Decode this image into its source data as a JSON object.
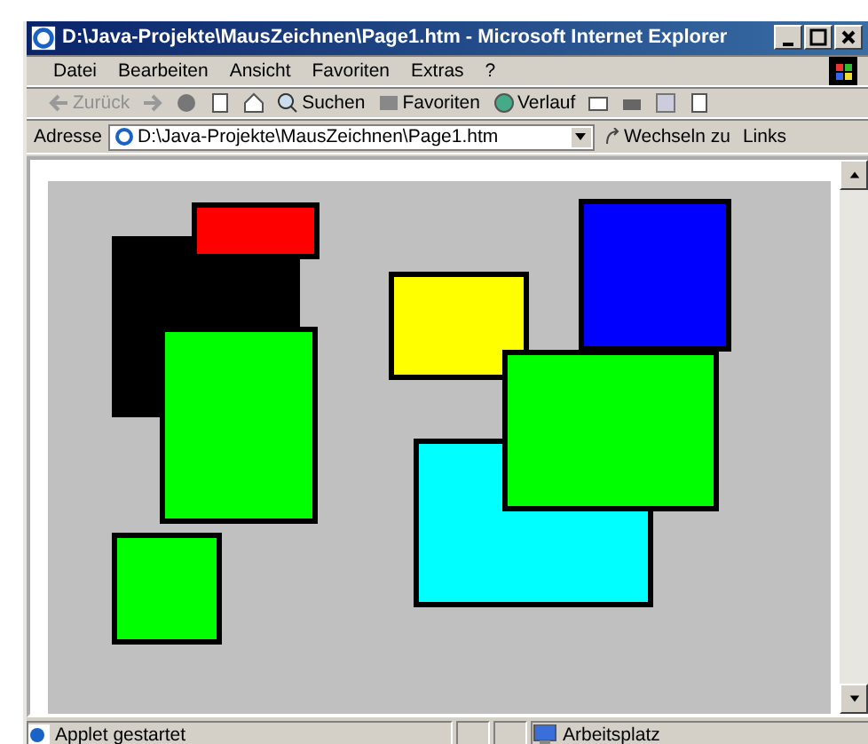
{
  "window": {
    "title": "D:\\Java-Projekte\\MausZeichnen\\Page1.htm - Microsoft Internet Explorer"
  },
  "menu": [
    "Datei",
    "Bearbeiten",
    "Ansicht",
    "Favoriten",
    "Extras",
    "?"
  ],
  "toolbar": [
    {
      "kind": "back",
      "label": "Zurück",
      "disabled": true
    },
    {
      "kind": "forward",
      "disabled": true
    },
    {
      "kind": "stop"
    },
    {
      "kind": "refresh"
    },
    {
      "kind": "home"
    },
    {
      "kind": "search",
      "label": "Suchen"
    },
    {
      "kind": "favorites",
      "label": "Favoriten"
    },
    {
      "kind": "history",
      "label": "Verlauf"
    },
    {
      "kind": "mail"
    },
    {
      "kind": "print"
    },
    {
      "kind": "edit"
    },
    {
      "kind": "discuss"
    }
  ],
  "address": {
    "label": "Adresse",
    "value": "D:\\Java-Projekte\\MausZeichnen\\Page1.htm",
    "go": "Wechseln zu",
    "links": "Links"
  },
  "applet": {
    "rectangles": [
      {
        "color": "#000000"
      },
      {
        "color": "#ff0000"
      },
      {
        "color": "#00ff00"
      },
      {
        "color": "#00ff00"
      },
      {
        "color": "#ffff00"
      },
      {
        "color": "#0000ff"
      },
      {
        "color": "#00ffff"
      },
      {
        "color": "#00ff00"
      }
    ]
  },
  "status_bar": {
    "message": "Applet gestartet",
    "zone": "Arbeitsplatz"
  }
}
